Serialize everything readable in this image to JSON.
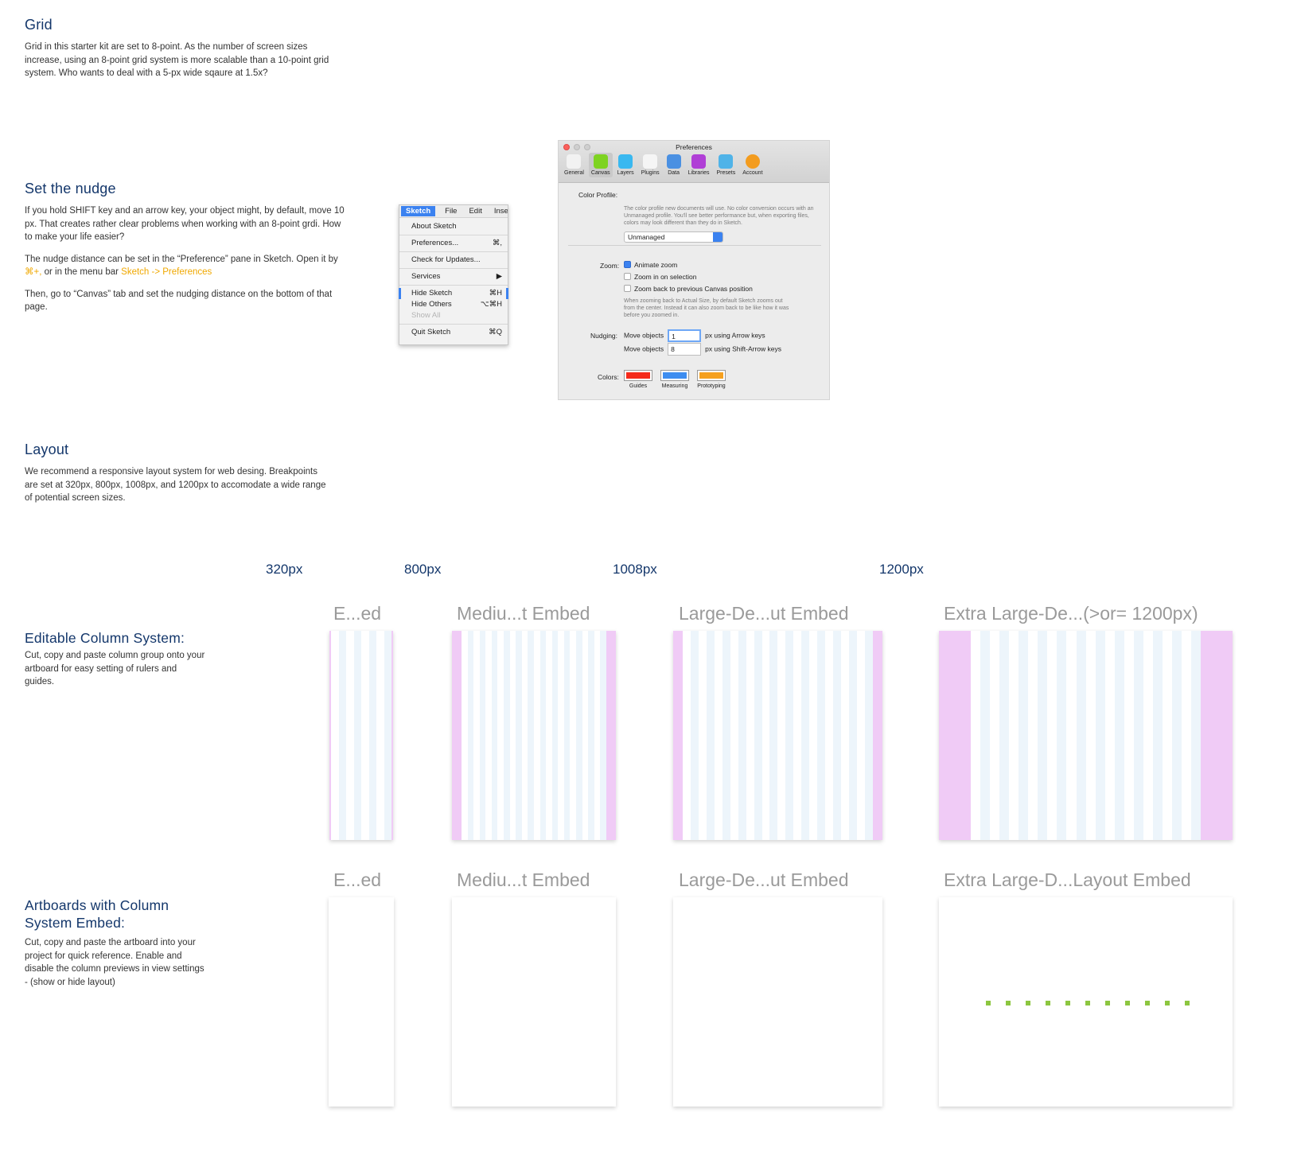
{
  "grid": {
    "heading": "Grid",
    "body": "Grid in this starter kit are set to 8-point. As the number of screen sizes increase, using an 8-point grid system is more scalable than a 10-point grid system. Who wants to deal with a 5-px wide sqaure at 1.5x?"
  },
  "nudge": {
    "heading": "Set the nudge",
    "p1": "If you hold SHIFT key and an arrow key, your object might, by default, move 10 px. That creates rather clear problems when working with an 8-point grdi. How to make your life easier?",
    "p2_a": "The nudge distance can be set in the “Preference” pane in Sketch. Open it by ",
    "p2_shortcut": "⌘+,",
    "p2_b": " or in the menu bar ",
    "p2_path": "Sketch -> Preferences",
    "p3": "Then, go to “Canvas” tab and set the nudging distance on the bottom of that page."
  },
  "sketch_menu": {
    "bar": [
      "Sketch",
      "File",
      "Edit",
      "Inser"
    ],
    "items": [
      {
        "label": "About Sketch",
        "shortcut": ""
      },
      {
        "label": "Preferences...",
        "shortcut": "⌘,"
      },
      {
        "label": "Check for Updates...",
        "shortcut": ""
      },
      {
        "label": "Services",
        "shortcut": "▶"
      },
      {
        "label": "Hide Sketch",
        "shortcut": "⌘H"
      },
      {
        "label": "Hide Others",
        "shortcut": "⌥⌘H"
      },
      {
        "label": "Show All",
        "shortcut": ""
      },
      {
        "label": "Quit Sketch",
        "shortcut": "⌘Q"
      }
    ]
  },
  "preferences": {
    "title": "Preferences",
    "tabs": [
      {
        "label": "General",
        "color": "#f2f2f2"
      },
      {
        "label": "Canvas",
        "color": "#7ed321"
      },
      {
        "label": "Layers",
        "color": "#39b8f0"
      },
      {
        "label": "Plugins",
        "color": "#f5f5f5"
      },
      {
        "label": "Data",
        "color": "#4a90e2"
      },
      {
        "label": "Libraries",
        "color": "#b03fd6"
      },
      {
        "label": "Presets",
        "color": "#4fb3e8"
      },
      {
        "label": "Account",
        "color": "#f39c1f"
      }
    ],
    "color_profile_label": "Color Profile:",
    "color_profile_value": "Unmanaged",
    "color_profile_note": "The color profile new documents will use. No color conversion occurs with an Unmanaged profile. You'll see better performance but, when exporting files, colors may look different than they do in Sketch.",
    "zoom_label": "Zoom:",
    "zoom_opts": [
      "Animate zoom",
      "Zoom in on selection",
      "Zoom back to previous Canvas position"
    ],
    "zoom_note": "When zooming back to Actual Size, by default Sketch zooms out from the center. Instead it can also zoom back to be like how it was before you zoomed in.",
    "nudging_label": "Nudging:",
    "move_objects": "Move objects",
    "nudge_small": "1",
    "nudge_small_suffix": "px using Arrow keys",
    "nudge_large": "8",
    "nudge_large_suffix": "px using Shift-Arrow keys",
    "colors_label": "Colors:",
    "swatches": [
      {
        "label": "Guides",
        "color": "#f52a1a"
      },
      {
        "label": "Measuring",
        "color": "#3d8df0"
      },
      {
        "label": "Prototyping",
        "color": "#f5a01e"
      }
    ]
  },
  "layout": {
    "heading": "Layout",
    "body": "We recommend a responsive layout system for web desing. Breakpoints are set at 320px, 800px, 1008px, and 1200px to accomodate a wide range of potential screen sizes."
  },
  "breakpoints": [
    "320px",
    "800px",
    "1008px",
    "1200px"
  ],
  "editable": {
    "heading": "Editable Column System:",
    "body": "Cut, copy and paste column group onto your artboard for easy setting of rulers and guides.",
    "titles": [
      "E...ed",
      "Mediu...t Embed",
      "Large-De...ut Embed",
      "Extra Large-De...(>or= 1200px)"
    ]
  },
  "artboards": {
    "heading": "Artboards with Column System Embed:",
    "body": "Cut, copy and paste the artboard into your project for quick reference. Enable and disable the column previews in view settings - (show or hide layout)",
    "titles": [
      "E...ed",
      "Mediu...t Embed",
      "Large-De...ut Embed",
      "Extra Large-D...Layout Embed"
    ]
  },
  "colors": {
    "heading": "#14376b",
    "highlight": "#f0a800",
    "margin": "#f0cbf6",
    "column": "#edf5fb",
    "dot": "#8cc63f"
  }
}
